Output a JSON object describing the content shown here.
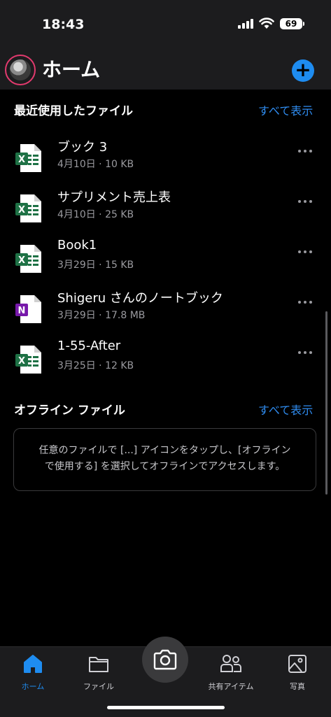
{
  "status": {
    "time": "18:43",
    "battery": "69"
  },
  "header": {
    "title": "ホーム",
    "add_label": "+"
  },
  "recent": {
    "title": "最近使用したファイル",
    "see_all": "すべて表示",
    "files": [
      {
        "name": "ブック 3",
        "meta": "4月10日 · 10 KB",
        "type": "excel",
        "icon_letter": "X"
      },
      {
        "name": "サプリメント売上表",
        "meta": "4月10日 · 25 KB",
        "type": "excel",
        "icon_letter": "X"
      },
      {
        "name": "Book1",
        "meta": "3月29日 · 15 KB",
        "type": "excel",
        "icon_letter": "X"
      },
      {
        "name": "Shigeru さんのノートブック",
        "meta": "3月29日 · 17.8 MB",
        "type": "onenote",
        "icon_letter": "N"
      },
      {
        "name": "1-55-After",
        "meta": "3月25日 · 12 KB",
        "type": "excel",
        "icon_letter": "X"
      }
    ]
  },
  "offline": {
    "title": "オフライン ファイル",
    "see_all": "すべて表示",
    "message_line1": "任意のファイルで [...] アイコンをタップし、[オフライン",
    "message_line2": "で使用する] を選択してオフラインでアクセスします。"
  },
  "tabs": [
    {
      "label": "ホーム",
      "icon": "home-icon",
      "active": true
    },
    {
      "label": "ファイル",
      "icon": "folder-icon",
      "active": false
    },
    {
      "label": "共有アイテム",
      "icon": "people-icon",
      "active": false
    },
    {
      "label": "写真",
      "icon": "photo-icon",
      "active": false
    }
  ],
  "colors": {
    "accent": "#1e8cf0",
    "excel": "#1e7145",
    "onenote": "#7719aa",
    "avatar_ring": "#e23a6e"
  }
}
